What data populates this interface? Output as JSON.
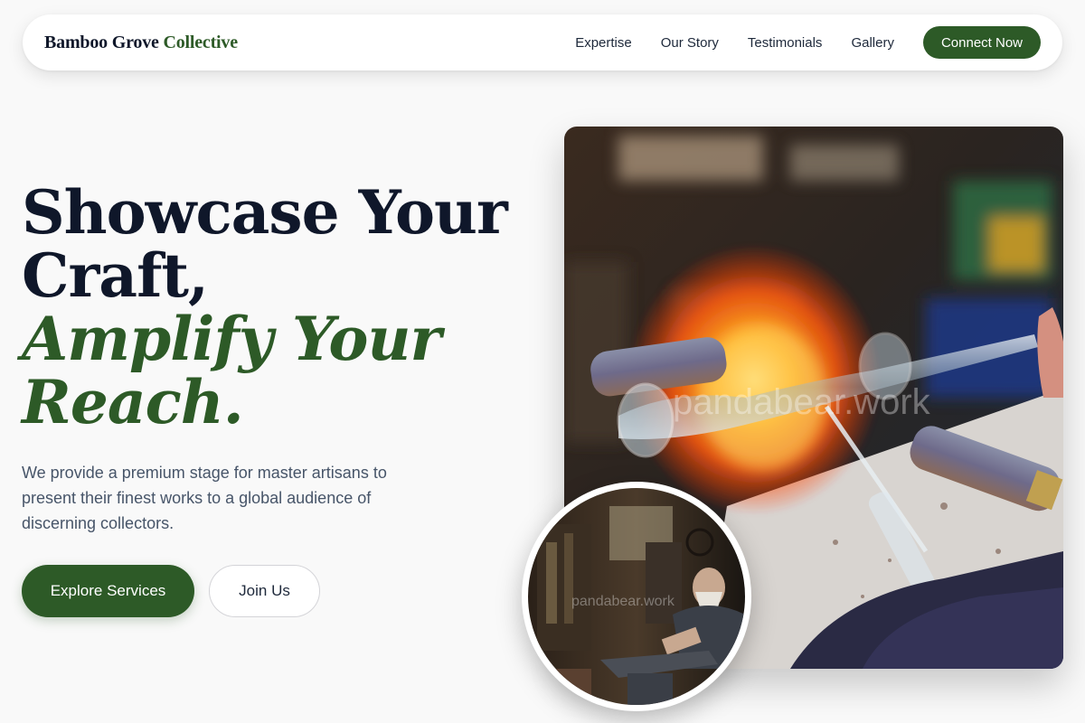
{
  "brand": {
    "name_part1": "Bamboo Grove ",
    "name_part2": "Collective"
  },
  "nav": {
    "links": [
      "Expertise",
      "Our Story",
      "Testimonials",
      "Gallery"
    ],
    "cta": "Connect Now"
  },
  "hero": {
    "headline_line1": "Showcase Your",
    "headline_line2": "Craft,",
    "headline_line3": "Amplify Your",
    "headline_line4": "Reach.",
    "subtext": "We provide a premium stage for master artisans to present their finest works to a global audience of discerning collectors.",
    "primary_button": "Explore Services",
    "secondary_button": "Join Us"
  },
  "images": {
    "main_watermark": "pandabear.work",
    "round_watermark": "pandabear.work"
  },
  "colors": {
    "accent": "#2d5a27",
    "heading": "#0f172a",
    "body_text": "#475569",
    "background": "#f9f9f9"
  }
}
